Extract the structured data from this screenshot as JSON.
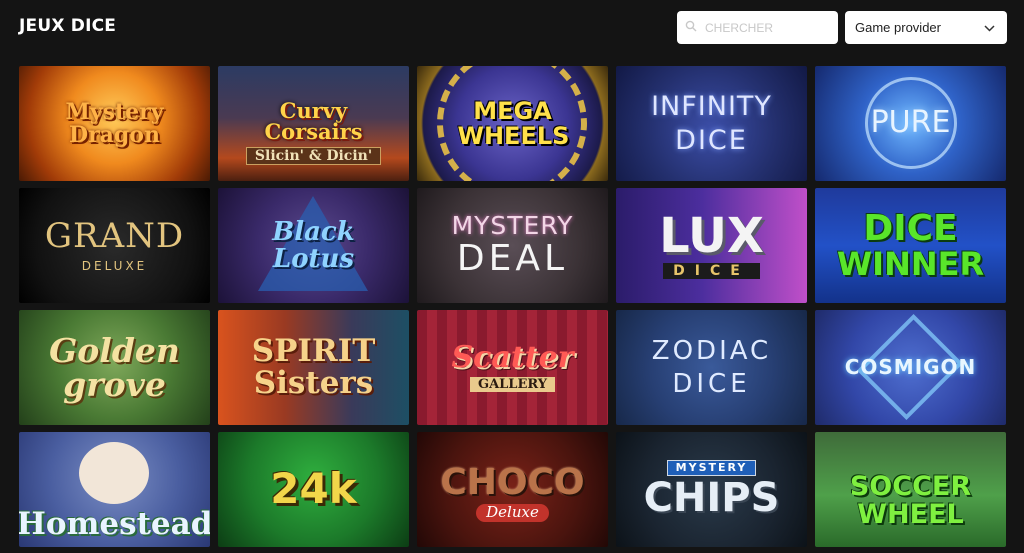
{
  "page": {
    "title": "JEUX DICE"
  },
  "search": {
    "placeholder": "CHERCHER"
  },
  "provider_select": {
    "value": "Game provider"
  },
  "games": [
    {
      "title": "Mystery Dragon"
    },
    {
      "title": "Curvy Corsairs",
      "subtitle": "Slicin' & Dicin'"
    },
    {
      "title": "MEGA WHEELS"
    },
    {
      "title": "INFINITY",
      "subtitle": "DICE"
    },
    {
      "title": "PURE"
    },
    {
      "title": "GRAND",
      "subtitle": "DELUXE"
    },
    {
      "title": "Black Lotus"
    },
    {
      "title": "MYSTERY",
      "subtitle": "DEAL"
    },
    {
      "title": "LUX",
      "subtitle": "DICE"
    },
    {
      "title": "DICE",
      "subtitle": "WINNER"
    },
    {
      "title": "Golden grove"
    },
    {
      "title": "SPIRIT Sisters"
    },
    {
      "title": "Scatter",
      "subtitle": "GALLERY"
    },
    {
      "title": "ZODIAC",
      "subtitle": "DICE"
    },
    {
      "title": "COSMIGON"
    },
    {
      "title": "Homestead"
    },
    {
      "title": "24k"
    },
    {
      "title": "CHOCO",
      "subtitle": "Deluxe"
    },
    {
      "title": "CHIPS",
      "subtitle": "MYSTERY"
    },
    {
      "title": "SOCCER",
      "subtitle": "WHEEL"
    }
  ]
}
